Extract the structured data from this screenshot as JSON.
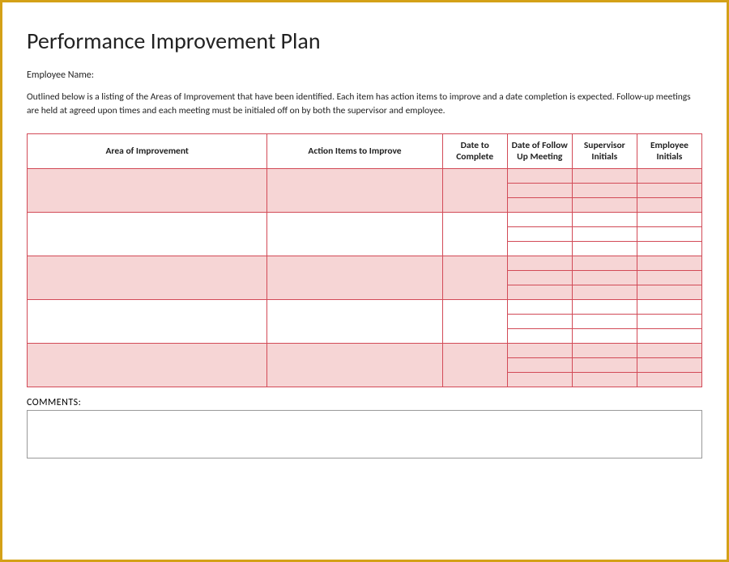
{
  "title": "Performance Improvement Plan",
  "employee_name_label": "Employee Name:",
  "description": "Outlined below is a listing of the Areas of Improvement that have been identified. Each item has action items to improve and a date completion is expected. Follow-up meetings are held at agreed upon times and each meeting must be initialed off on by both the supervisor and employee.",
  "headers": {
    "area": "Area of Improvement",
    "action": "Action Items to Improve",
    "date_complete": "Date to Complete",
    "date_follow": "Date of Follow Up Meeting",
    "supervisor_initials": "Supervisor Initials",
    "employee_initials": "Employee Initials"
  },
  "comments_label": "COMMENTS:"
}
